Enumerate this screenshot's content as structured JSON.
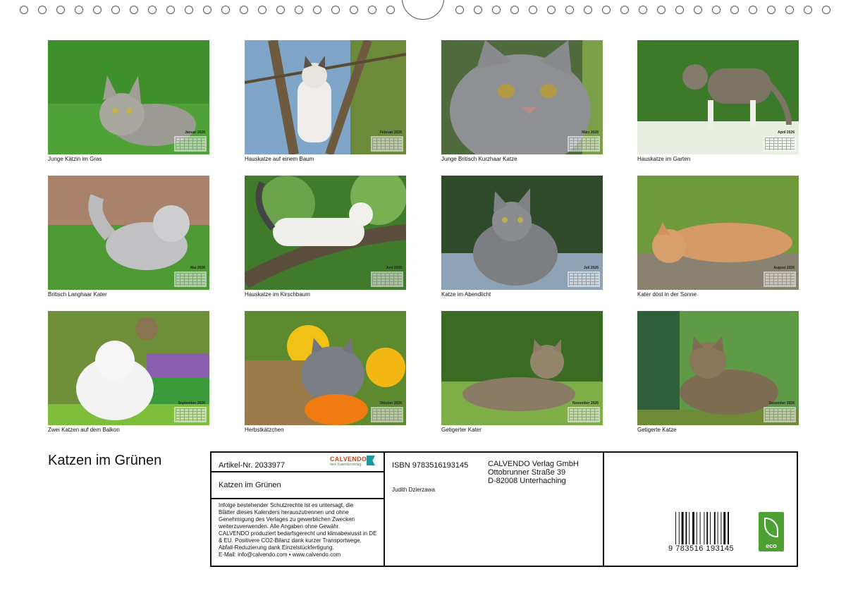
{
  "photos": [
    {
      "caption": "Junge Kätzin im Gras",
      "month": "Januar 2026"
    },
    {
      "caption": "Hauskatze auf einem Baum",
      "month": "Februar 2026"
    },
    {
      "caption": "Junge Britisch Kurzhaar Katze",
      "month": "März 2026"
    },
    {
      "caption": "Hauskatze im Garten",
      "month": "April 2026"
    },
    {
      "caption": "Britisch Langhaar Kater",
      "month": "Mai 2026"
    },
    {
      "caption": "Hauskatze im Kirschbaum",
      "month": "Juni 2026"
    },
    {
      "caption": "Katze im Abendlicht",
      "month": "Juli 2026"
    },
    {
      "caption": "Kater döst in der Sonne",
      "month": "August 2026"
    },
    {
      "caption": "Zwei Katzen auf dem Balkon",
      "month": "September 2026"
    },
    {
      "caption": "Herbstkätzchen",
      "month": "Oktober 2026"
    },
    {
      "caption": "Getigerter Kater",
      "month": "November 2026"
    },
    {
      "caption": "Getigerte Katze",
      "month": "Dezember 2026"
    }
  ],
  "title": "Katzen im Grünen",
  "info": {
    "article_no": "Artikel-Nr. 2033977",
    "publisher_logo": "CALVENDO",
    "publisher_logo_sub": "dein Kalenderverlag",
    "product_title": "Katzen im Grünen",
    "legal_lines": [
      "Infolge bestehender Schutzrechte ist es untersagt, die",
      "Blätter dieses Kalenders herauszutrennen und ohne",
      "Genehmigung des Verlages zu gewerblichen Zwecken",
      "weiterzuverwenden. Alle Angaben ohne Gewähr.",
      "CALVENDO produziert bedarfsgerecht und klimabewusst in DE",
      "& EU. Positivere CO2-Bilanz dank kurzer Transportwege.",
      "Abfall-Reduzierung dank Einzelstückfertigung.",
      "E-Mail: info@calvendo.com • www.calvendo.com"
    ],
    "isbn": "ISBN 9783516193145",
    "author": "Judith Dzierzawa",
    "publisher_name": "CALVENDO Verlag GmbH",
    "publisher_street": "Ottobrunner Straße 39",
    "publisher_city": "D-82008 Unterhaching",
    "barcode_number": "9 783516 193145",
    "eco_label": "eco"
  }
}
